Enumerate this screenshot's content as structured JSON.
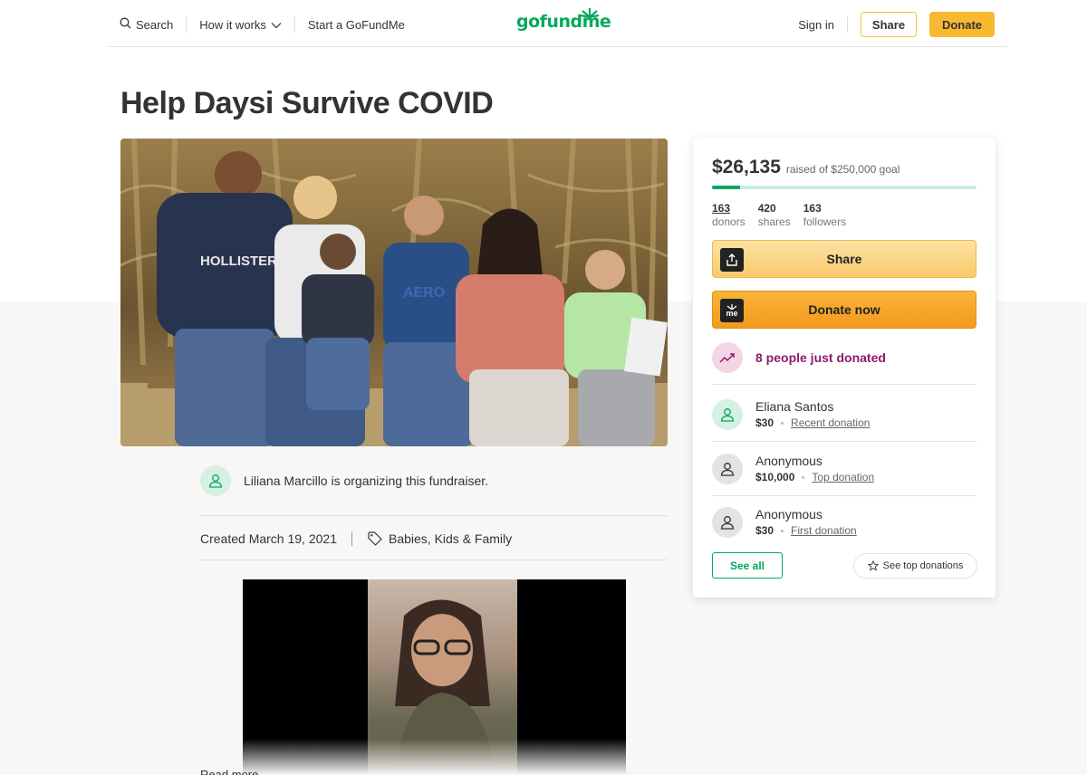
{
  "nav": {
    "search_label": "Search",
    "how_it_works_label": "How it works",
    "start_label": "Start a GoFundMe",
    "logo_text": "gofundme",
    "sign_in_label": "Sign in",
    "share_label": "Share",
    "donate_label": "Donate"
  },
  "campaign": {
    "title": "Help Daysi Survive COVID",
    "organizer_text": "Liliana Marcillo is organizing this fundraiser.",
    "created": "Created March 19, 2021",
    "category": "Babies, Kids & Family",
    "read_more": "Read more"
  },
  "sidebar": {
    "raised_amount": "$26,135",
    "goal_text": "raised of $250,000 goal",
    "progress_fraction": 0.105,
    "stats": [
      {
        "num": "163",
        "label": "donors"
      },
      {
        "num": "420",
        "label": "shares"
      },
      {
        "num": "163",
        "label": "followers"
      }
    ],
    "share_button": "Share",
    "donate_button": "Donate now",
    "donate_icon_text": "me",
    "just_donated": "8 people just donated",
    "donations": [
      {
        "name": "Eliana Santos",
        "amount": "$30",
        "type": "Recent donation"
      },
      {
        "name": "Anonymous",
        "amount": "$10,000",
        "type": "Top donation"
      },
      {
        "name": "Anonymous",
        "amount": "$30",
        "type": "First donation"
      }
    ],
    "see_all": "See all",
    "see_top": "See top donations"
  },
  "colors": {
    "brand_green": "#02a95c",
    "donate_yellow": "#f8b931",
    "highlight_purple": "#8b1a6b"
  }
}
